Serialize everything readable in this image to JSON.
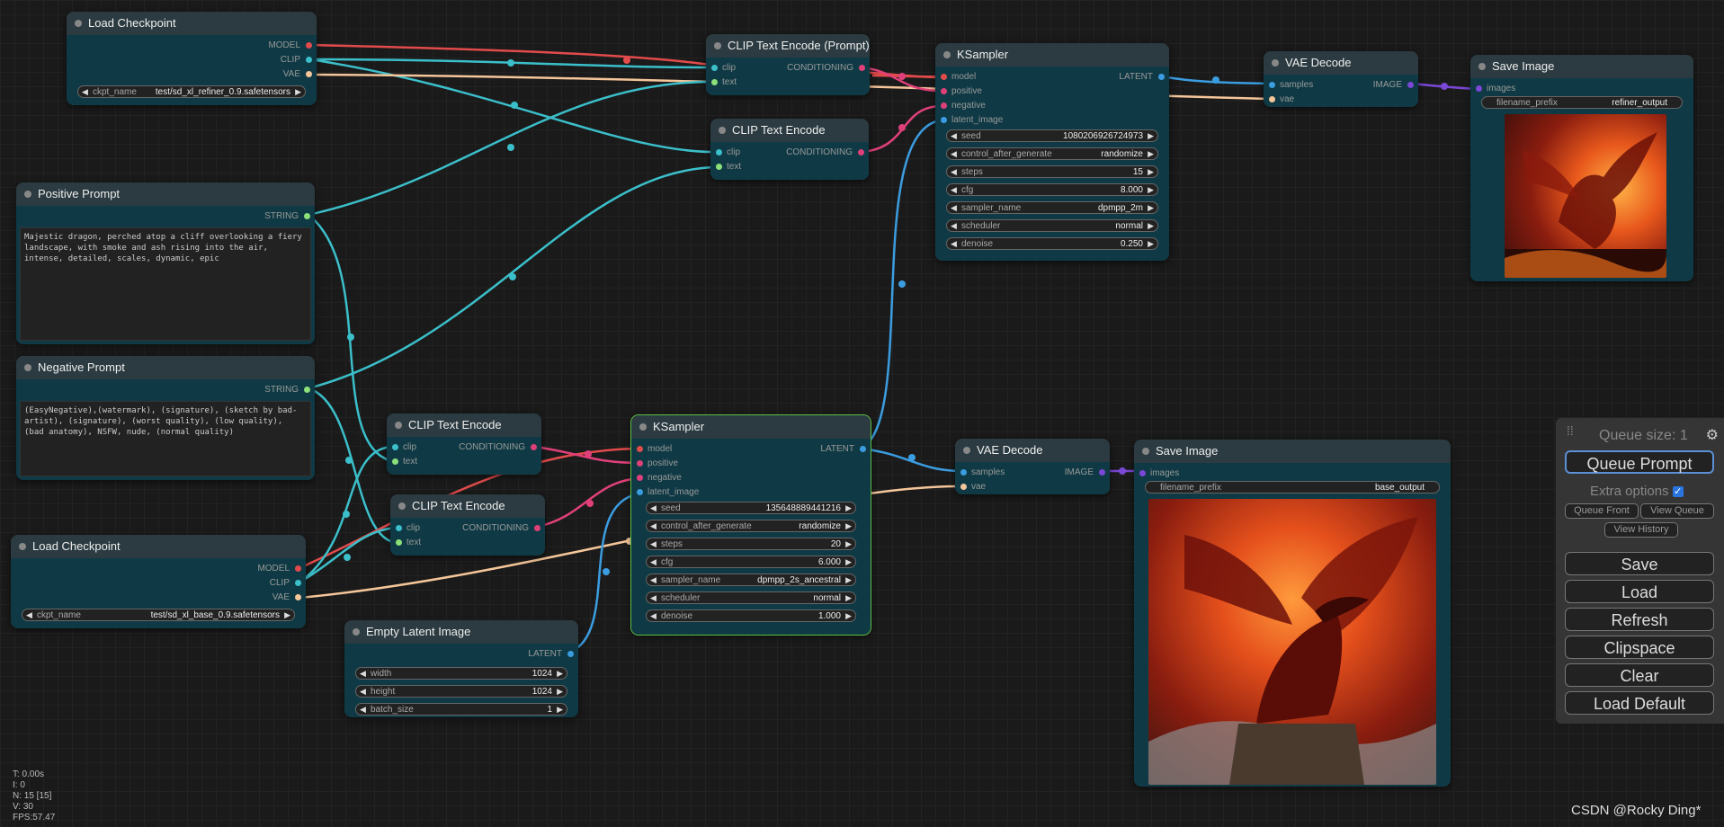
{
  "colors": {
    "model": "#e24b4b",
    "clip": "#3bbfca",
    "vae": "#f5c69a",
    "conditioning": "#e0407a",
    "latent": "#3b9de0",
    "string": "#8ce07a",
    "image": "#7a47d6"
  },
  "nodes": {
    "load_ckpt_refiner": {
      "title": "Load Checkpoint",
      "outputs": [
        "MODEL",
        "CLIP",
        "VAE"
      ],
      "widget": {
        "label": "ckpt_name",
        "value": "test/sd_xl_refiner_0.9.safetensors"
      }
    },
    "clip_enc_1": {
      "title": "CLIP Text Encode (Prompt)",
      "inputs": [
        "clip",
        "text"
      ],
      "output": "CONDITIONING"
    },
    "clip_enc_2": {
      "title": "CLIP Text Encode (Prompt)",
      "inputs": [
        "clip",
        "text"
      ],
      "output": "CONDITIONING"
    },
    "ksampler_refiner": {
      "title": "KSampler",
      "inputs": [
        "model",
        "positive",
        "negative",
        "latent_image"
      ],
      "output": "LATENT",
      "widgets": [
        {
          "label": "seed",
          "value": "1080206926724973"
        },
        {
          "label": "control_after_generate",
          "value": "randomize"
        },
        {
          "label": "steps",
          "value": "15"
        },
        {
          "label": "cfg",
          "value": "8.000"
        },
        {
          "label": "sampler_name",
          "value": "dpmpp_2m"
        },
        {
          "label": "scheduler",
          "value": "normal"
        },
        {
          "label": "denoise",
          "value": "0.250"
        }
      ]
    },
    "vae_decode_refiner": {
      "title": "VAE Decode",
      "inputs": [
        "samples",
        "vae"
      ],
      "output": "IMAGE"
    },
    "save_image_refiner": {
      "title": "Save Image",
      "input": "images",
      "widget": {
        "label": "filename_prefix",
        "value": "refiner_output"
      }
    },
    "positive_prompt": {
      "title": "Positive Prompt",
      "output": "STRING",
      "text": "Majestic dragon, perched atop a cliff overlooking a fiery landscape, with smoke and ash rising into the air, intense, detailed, scales, dynamic, epic"
    },
    "negative_prompt": {
      "title": "Negative Prompt",
      "output": "STRING",
      "text": "(EasyNegative),(watermark), (signature), (sketch by bad-artist), (signature), (worst quality), (low quality), (bad anatomy), NSFW, nude, (normal quality)"
    },
    "clip_enc_3": {
      "title": "CLIP Text Encode (Prompt)",
      "inputs": [
        "clip",
        "text"
      ],
      "output": "CONDITIONING"
    },
    "clip_enc_4": {
      "title": "CLIP Text Encode (Prompt)",
      "inputs": [
        "clip",
        "text"
      ],
      "output": "CONDITIONING"
    },
    "load_ckpt_base": {
      "title": "Load Checkpoint",
      "outputs": [
        "MODEL",
        "CLIP",
        "VAE"
      ],
      "widget": {
        "label": "ckpt_name",
        "value": "test/sd_xl_base_0.9.safetensors"
      }
    },
    "empty_latent": {
      "title": "Empty Latent Image",
      "output": "LATENT",
      "widgets": [
        {
          "label": "width",
          "value": "1024"
        },
        {
          "label": "height",
          "value": "1024"
        },
        {
          "label": "batch_size",
          "value": "1"
        }
      ]
    },
    "ksampler_base": {
      "title": "KSampler",
      "inputs": [
        "model",
        "positive",
        "negative",
        "latent_image"
      ],
      "output": "LATENT",
      "widgets": [
        {
          "label": "seed",
          "value": "135648889441216"
        },
        {
          "label": "control_after_generate",
          "value": "randomize"
        },
        {
          "label": "steps",
          "value": "20"
        },
        {
          "label": "cfg",
          "value": "6.000"
        },
        {
          "label": "sampler_name",
          "value": "dpmpp_2s_ancestral"
        },
        {
          "label": "scheduler",
          "value": "normal"
        },
        {
          "label": "denoise",
          "value": "1.000"
        }
      ]
    },
    "vae_decode_base": {
      "title": "VAE Decode",
      "inputs": [
        "samples",
        "vae"
      ],
      "output": "IMAGE"
    },
    "save_image_base": {
      "title": "Save Image",
      "input": "images",
      "widget": {
        "label": "filename_prefix",
        "value": "base_output"
      }
    }
  },
  "menu": {
    "queue_size": "Queue size: 1",
    "queue_prompt": "Queue Prompt",
    "extra_options": "Extra options",
    "queue_front": "Queue Front",
    "view_queue": "View Queue",
    "view_history": "View History",
    "save": "Save",
    "load": "Load",
    "refresh": "Refresh",
    "clipspace": "Clipspace",
    "clear": "Clear",
    "load_default": "Load Default"
  },
  "stats": {
    "t": "T: 0.00s",
    "i": "I: 0",
    "n": "N: 15 [15]",
    "v": "V: 30",
    "fps": "FPS:57.47"
  },
  "watermark": "CSDN @Rocky Ding*"
}
